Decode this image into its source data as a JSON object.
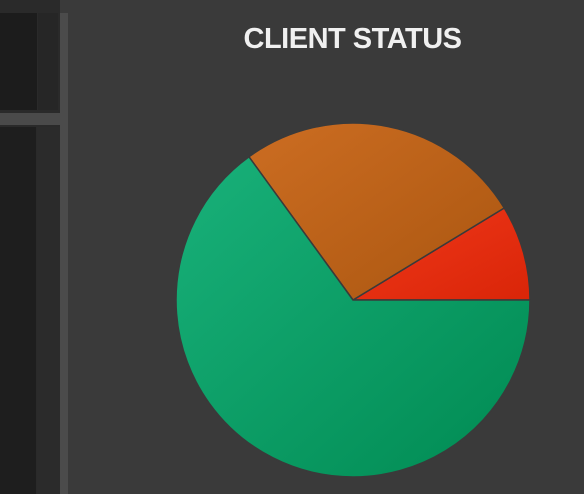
{
  "chart_data": {
    "type": "pie",
    "title": "CLIENT STATUS",
    "slices": [
      {
        "value": 8.7,
        "color": "#e82e0e"
      },
      {
        "value": 26.3,
        "color": "#c16217"
      },
      {
        "value": 65.0,
        "color": "#0d9a62"
      }
    ]
  },
  "colors": {
    "background": "#3a3a3a",
    "title": "#f0f0f0",
    "slice_border": "#3a3a3a"
  }
}
